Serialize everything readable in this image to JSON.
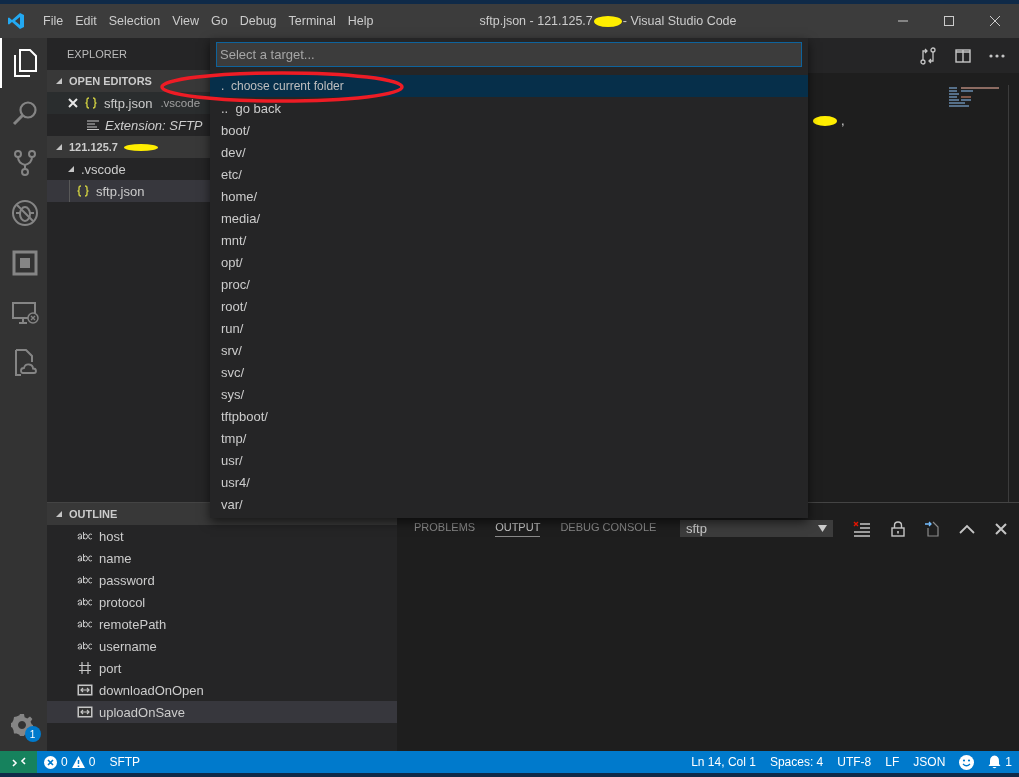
{
  "window": {
    "title": "sftp.json - 121.125.7",
    "title_suffix": "- Visual Studio Code"
  },
  "menu": [
    "File",
    "Edit",
    "Selection",
    "View",
    "Go",
    "Debug",
    "Terminal",
    "Help"
  ],
  "activity_bar": [
    {
      "kind": "files",
      "selected": true
    },
    {
      "kind": "search",
      "selected": false
    },
    {
      "kind": "source-control",
      "selected": false
    },
    {
      "kind": "debug",
      "selected": false
    },
    {
      "kind": "extensions",
      "selected": false
    },
    {
      "kind": "remote",
      "selected": false
    },
    {
      "kind": "cloud-file",
      "selected": false
    }
  ],
  "settings_badge": "1",
  "sidebar": {
    "title": "EXPLORER",
    "open_editors": {
      "title": "OPEN EDITORS",
      "expanded": true,
      "items": [
        {
          "kind": "json",
          "name": "sftp.json",
          "detail": ".vscode"
        },
        {
          "kind": "extension",
          "name": "Extension: SFTP"
        }
      ]
    },
    "folder": {
      "title": "121.125.7",
      "expanded": true,
      "children": [
        {
          "name": ".vscode",
          "kind": "folder",
          "expanded": true,
          "selected": false,
          "children": [
            {
              "name": "sftp.json",
              "kind": "json",
              "selected": true
            }
          ]
        }
      ]
    },
    "outline": {
      "title": "OUTLINE",
      "expanded": true,
      "items": [
        {
          "kind": "string",
          "name": "host",
          "selected": false
        },
        {
          "kind": "string",
          "name": "name",
          "selected": false
        },
        {
          "kind": "string",
          "name": "password",
          "selected": false
        },
        {
          "kind": "string",
          "name": "protocol",
          "selected": false
        },
        {
          "kind": "string",
          "name": "remotePath",
          "selected": false
        },
        {
          "kind": "string",
          "name": "username",
          "selected": false
        },
        {
          "kind": "number",
          "name": "port",
          "selected": false
        },
        {
          "kind": "boolean",
          "name": "downloadOnOpen",
          "selected": false
        },
        {
          "kind": "boolean",
          "name": "uploadOnSave",
          "selected": true
        }
      ]
    }
  },
  "quick_pick": {
    "placeholder": "Select a target...",
    "items": [
      {
        "label": ".  choose current folder",
        "selected": true
      },
      {
        "label": "..  go back",
        "selected": false
      },
      {
        "label": "boot/",
        "selected": false
      },
      {
        "label": "dev/",
        "selected": false
      },
      {
        "label": "etc/",
        "selected": false
      },
      {
        "label": "home/",
        "selected": false
      },
      {
        "label": "media/",
        "selected": false
      },
      {
        "label": "mnt/",
        "selected": false
      },
      {
        "label": "opt/",
        "selected": false
      },
      {
        "label": "proc/",
        "selected": false
      },
      {
        "label": "root/",
        "selected": false
      },
      {
        "label": "run/",
        "selected": false
      },
      {
        "label": "srv/",
        "selected": false
      },
      {
        "label": "svc/",
        "selected": false
      },
      {
        "label": "sys/",
        "selected": false
      },
      {
        "label": "tftpboot/",
        "selected": false
      },
      {
        "label": "tmp/",
        "selected": false
      },
      {
        "label": "usr/",
        "selected": false
      },
      {
        "label": "usr4/",
        "selected": false
      },
      {
        "label": "var/",
        "selected": false
      }
    ]
  },
  "editor": {
    "text": ","
  },
  "panel": {
    "tabs": [
      {
        "label": "PROBLEMS",
        "selected": false
      },
      {
        "label": "OUTPUT",
        "selected": true
      },
      {
        "label": "DEBUG CONSOLE",
        "selected": false
      }
    ],
    "channel": "sftp"
  },
  "status_bar": {
    "errors": "0",
    "warnings": "0",
    "left": [
      "SFTP"
    ],
    "right": [
      "Ln 14, Col 1",
      "Spaces: 4",
      "UTF-8",
      "LF",
      "JSON"
    ],
    "notifications": "1"
  }
}
